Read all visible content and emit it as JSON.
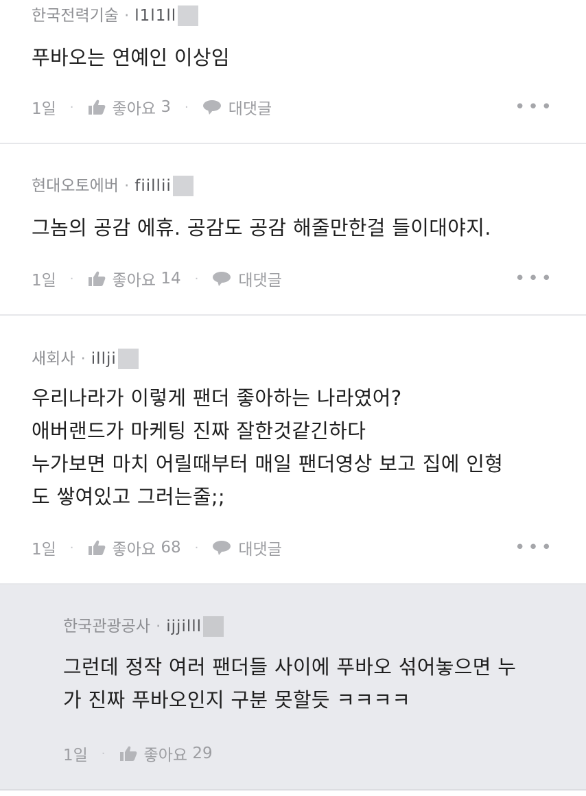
{
  "comments": [
    {
      "company": "한국전력기술",
      "user_id": "l1l1ll",
      "text_lines": [
        "푸바오는 연예인 이상임"
      ],
      "time": "1일",
      "like_label": "좋아요",
      "like_count": "3",
      "reply_label": "대댓글",
      "more": "•••"
    },
    {
      "company": "현대오토에버",
      "user_id": "fiillii",
      "text_lines": [
        "그놈의 공감 에휴. 공감도 공감 해줄만한걸 들이대야지."
      ],
      "time": "1일",
      "like_label": "좋아요",
      "like_count": "14",
      "reply_label": "대댓글",
      "more": "•••"
    },
    {
      "company": "새회사",
      "user_id": "illji",
      "text_lines": [
        "우리나라가 이렇게 팬더 좋아하는 나라였어?",
        "애버랜드가 마케팅 진짜 잘한것같긴하다",
        "누가보면 마치 어릴때부터 매일 팬더영상 보고 집에 인형",
        "도 쌓여있고 그러는줄;;"
      ],
      "time": "1일",
      "like_label": "좋아요",
      "like_count": "68",
      "reply_label": "대댓글",
      "more": "•••"
    }
  ],
  "reply": {
    "company": "한국관광공사",
    "user_id": "ijjilll",
    "text_lines": [
      "그런데 정작 여러 팬더들 사이에 푸바오 섞어놓으면 누",
      "가 진짜 푸바오인지 구분 못할듯 ㅋㅋㅋㅋ"
    ],
    "time": "1일",
    "like_label": "좋아요",
    "like_count": "29"
  },
  "colors": {
    "reply_background": "#e9eaee",
    "divider": "#e6e7ea",
    "meta_text": "#8e8f93"
  },
  "icons": [
    "thumbs-up-icon",
    "speech-bubble-icon",
    "more-dots-icon"
  ]
}
